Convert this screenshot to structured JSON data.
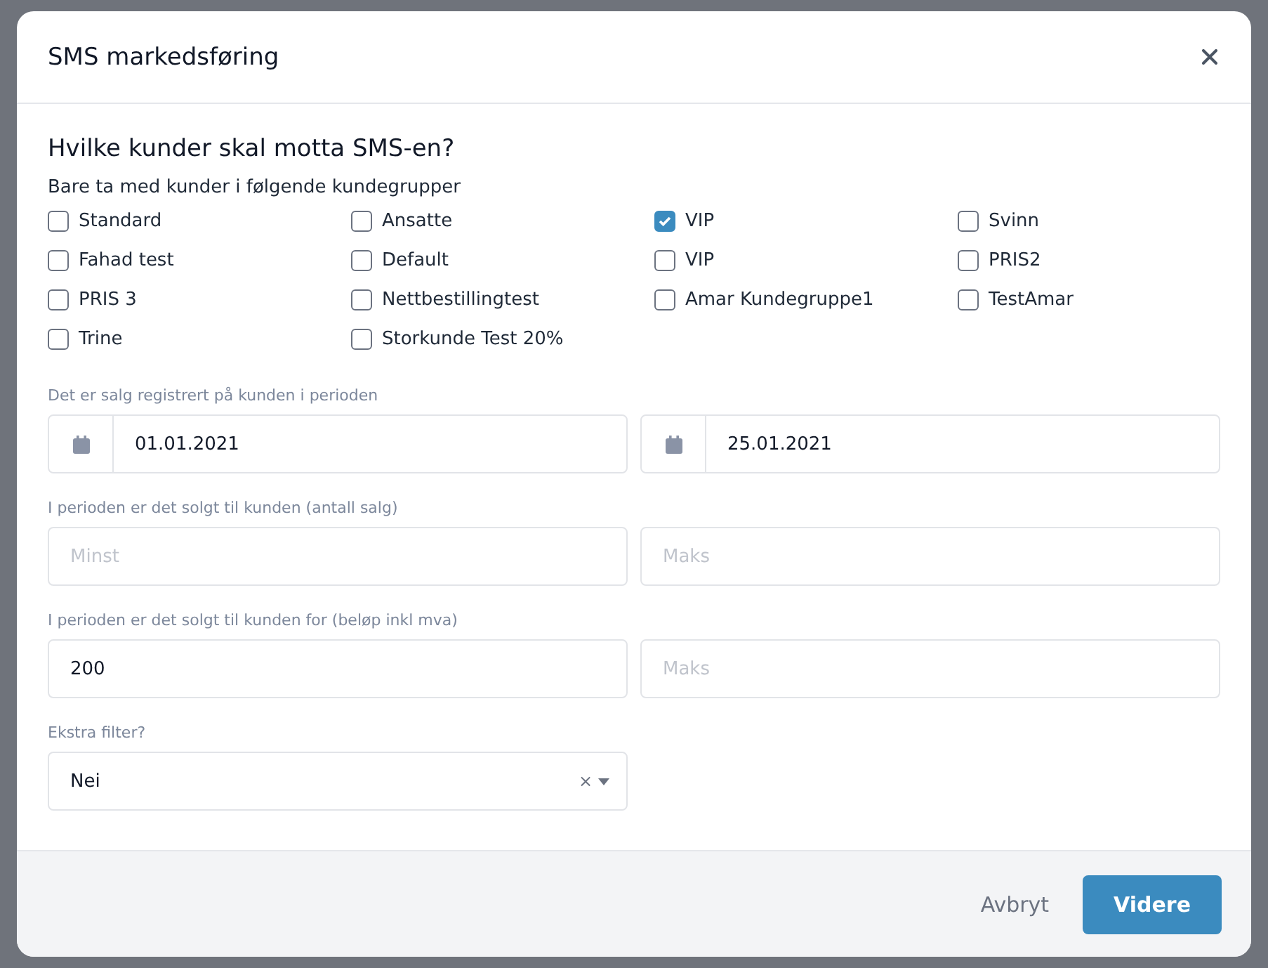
{
  "dialog": {
    "title": "SMS markedsføring",
    "question": "Hvilke kunder skal motta SMS-en?",
    "groups_label": "Bare ta med kunder i følgende kundegrupper",
    "groups": [
      {
        "label": "Standard",
        "checked": false
      },
      {
        "label": "Ansatte",
        "checked": false
      },
      {
        "label": "VIP",
        "checked": true
      },
      {
        "label": "Svinn",
        "checked": false
      },
      {
        "label": "Fahad test",
        "checked": false
      },
      {
        "label": "Default",
        "checked": false
      },
      {
        "label": "VIP",
        "checked": false
      },
      {
        "label": "PRIS2",
        "checked": false
      },
      {
        "label": "PRIS 3",
        "checked": false
      },
      {
        "label": "Nettbestillingtest",
        "checked": false
      },
      {
        "label": "Amar Kundegruppe1",
        "checked": false
      },
      {
        "label": "TestAmar",
        "checked": false
      },
      {
        "label": "Trine",
        "checked": false
      },
      {
        "label": "Storkunde Test 20%",
        "checked": false
      }
    ],
    "filters": [
      {
        "label": "Det er salg registrert på kunden i perioden",
        "fields": [
          {
            "kind": "date",
            "value": "01.01.2021"
          },
          {
            "kind": "date",
            "value": "25.01.2021"
          }
        ]
      },
      {
        "label": "I perioden er det solgt til kunden (antall salg)",
        "fields": [
          {
            "kind": "text",
            "placeholder": "Minst"
          },
          {
            "kind": "text",
            "placeholder": "Maks"
          }
        ]
      },
      {
        "label": "I perioden er det solgt til kunden for (beløp inkl mva)",
        "fields": [
          {
            "kind": "text",
            "value": "200"
          },
          {
            "kind": "text",
            "placeholder": "Maks"
          }
        ]
      },
      {
        "label": "Ekstra filter?",
        "fields": [
          {
            "kind": "select",
            "value": "Nei",
            "clear": "×"
          }
        ]
      }
    ],
    "buttons": [
      {
        "label": "Avbryt",
        "kind": "secondary"
      },
      {
        "label": "Videre",
        "kind": "primary"
      }
    ]
  }
}
